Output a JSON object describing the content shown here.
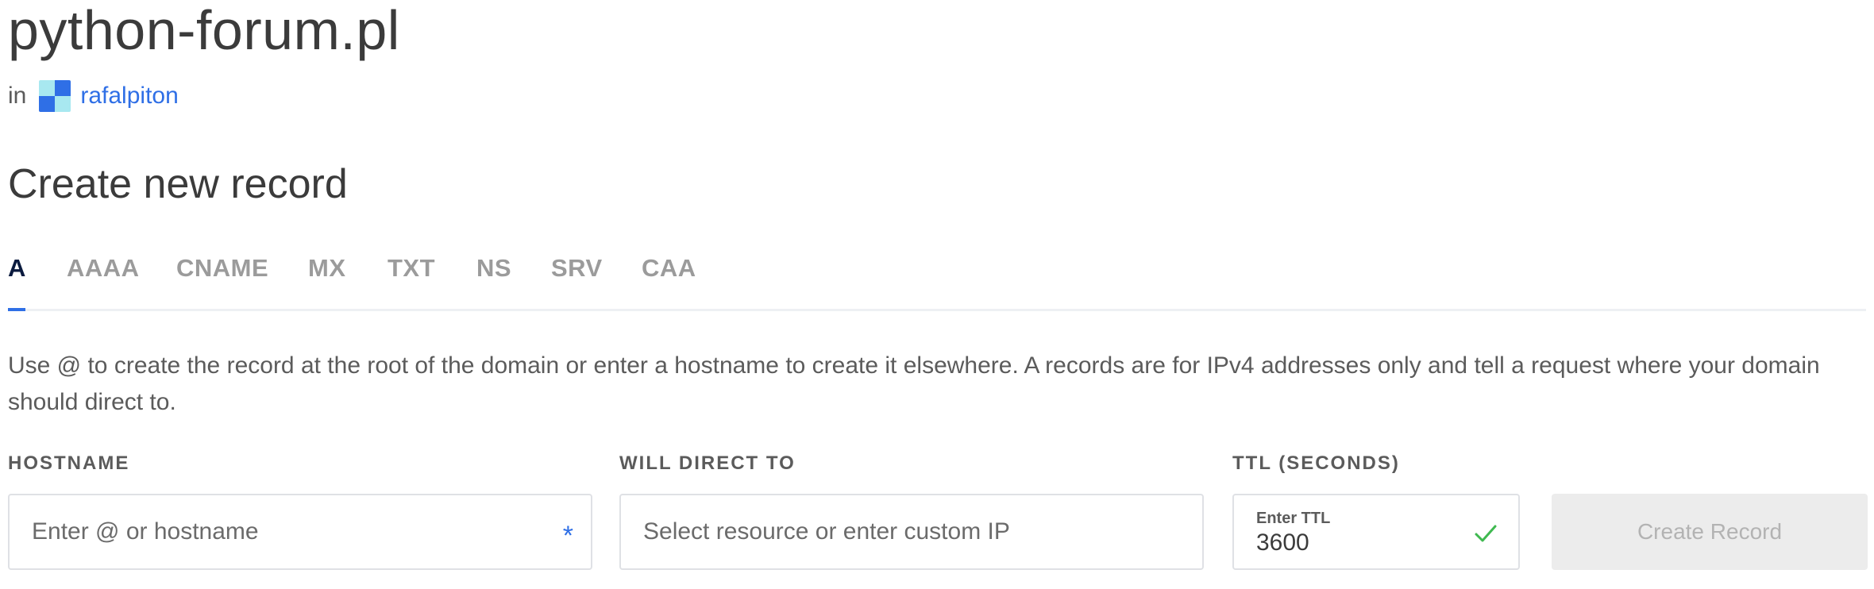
{
  "domain": {
    "name": "python-forum.pl",
    "in_label": "in",
    "team_name": "rafalpiton"
  },
  "section": {
    "title": "Create new record"
  },
  "tabs": [
    {
      "label": "A",
      "active": true
    },
    {
      "label": "AAAA",
      "active": false
    },
    {
      "label": "CNAME",
      "active": false
    },
    {
      "label": "MX",
      "active": false
    },
    {
      "label": "TXT",
      "active": false
    },
    {
      "label": "NS",
      "active": false
    },
    {
      "label": "SRV",
      "active": false
    },
    {
      "label": "CAA",
      "active": false
    }
  ],
  "description": "Use @ to create the record at the root of the domain or enter a hostname to create it elsewhere. A records are for IPv4 addresses only and tell a request where your domain should direct to.",
  "form": {
    "hostname": {
      "label": "HOSTNAME",
      "placeholder": "Enter @ or hostname",
      "required_mark": "*"
    },
    "direct_to": {
      "label": "WILL DIRECT TO",
      "placeholder": "Select resource or enter custom IP"
    },
    "ttl": {
      "label": "TTL (SECONDS)",
      "caption": "Enter TTL",
      "value": "3600"
    },
    "submit_label": "Create Record"
  },
  "colors": {
    "accent": "#2f6fe6",
    "active_tab": "#0b1b3f",
    "valid_check": "#3fb950",
    "button_disabled_bg": "#ececec"
  },
  "icons": {
    "team": "team-avatar-icon",
    "ttl_valid": "check-icon"
  }
}
